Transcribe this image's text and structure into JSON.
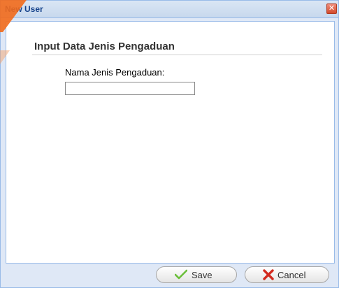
{
  "window": {
    "title": "New User",
    "close_icon": "close-icon"
  },
  "form": {
    "section_title": "Input Data Jenis Pengaduan",
    "field_label": "Nama Jenis Pengaduan:",
    "field_value": "",
    "field_placeholder": ""
  },
  "footer": {
    "save_label": "Save",
    "save_icon": "checkmark-icon",
    "cancel_label": "Cancel",
    "cancel_icon": "red-x-icon"
  },
  "colors": {
    "title_text": "#15428b",
    "window_border": "#99bbe8",
    "window_bg": "#dfe8f6",
    "ribbon": "#f26a1b",
    "save_check": "#6bbf3b",
    "cancel_x": "#d22a1f"
  }
}
